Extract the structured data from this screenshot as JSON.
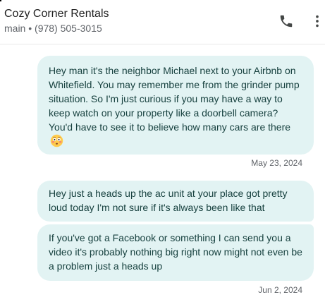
{
  "header": {
    "contact_name": "Cozy Corner Rentals",
    "contact_detail": "main • (978) 505-3015",
    "call_icon": "phone-icon",
    "more_icon": "more-vert-icon"
  },
  "messages": [
    {
      "text": "Hey man it's the neighbor Michael next to your Airbnb on Whitefield.  You may remember me from the grinder pump situation.  So I'm just curious if you may have a way to keep watch on your property like a doorbell camera?  You'd have to see it to believe how many cars are there",
      "emoji": "flushed-face-emoji"
    },
    {
      "text": "Hey just a heads up the ac unit at your place got pretty loud today I'm not sure if it's always been like that"
    },
    {
      "text": "If you've got a Facebook or something I can send you a video it's probably nothing big right now might not even be a problem just a heads up"
    }
  ],
  "timestamps": [
    "May 23, 2024",
    "Jun 2, 2024"
  ],
  "colors": {
    "bubble_background": "#e2f3f3",
    "bubble_text": "#17413f",
    "secondary_text": "#5f6368"
  }
}
